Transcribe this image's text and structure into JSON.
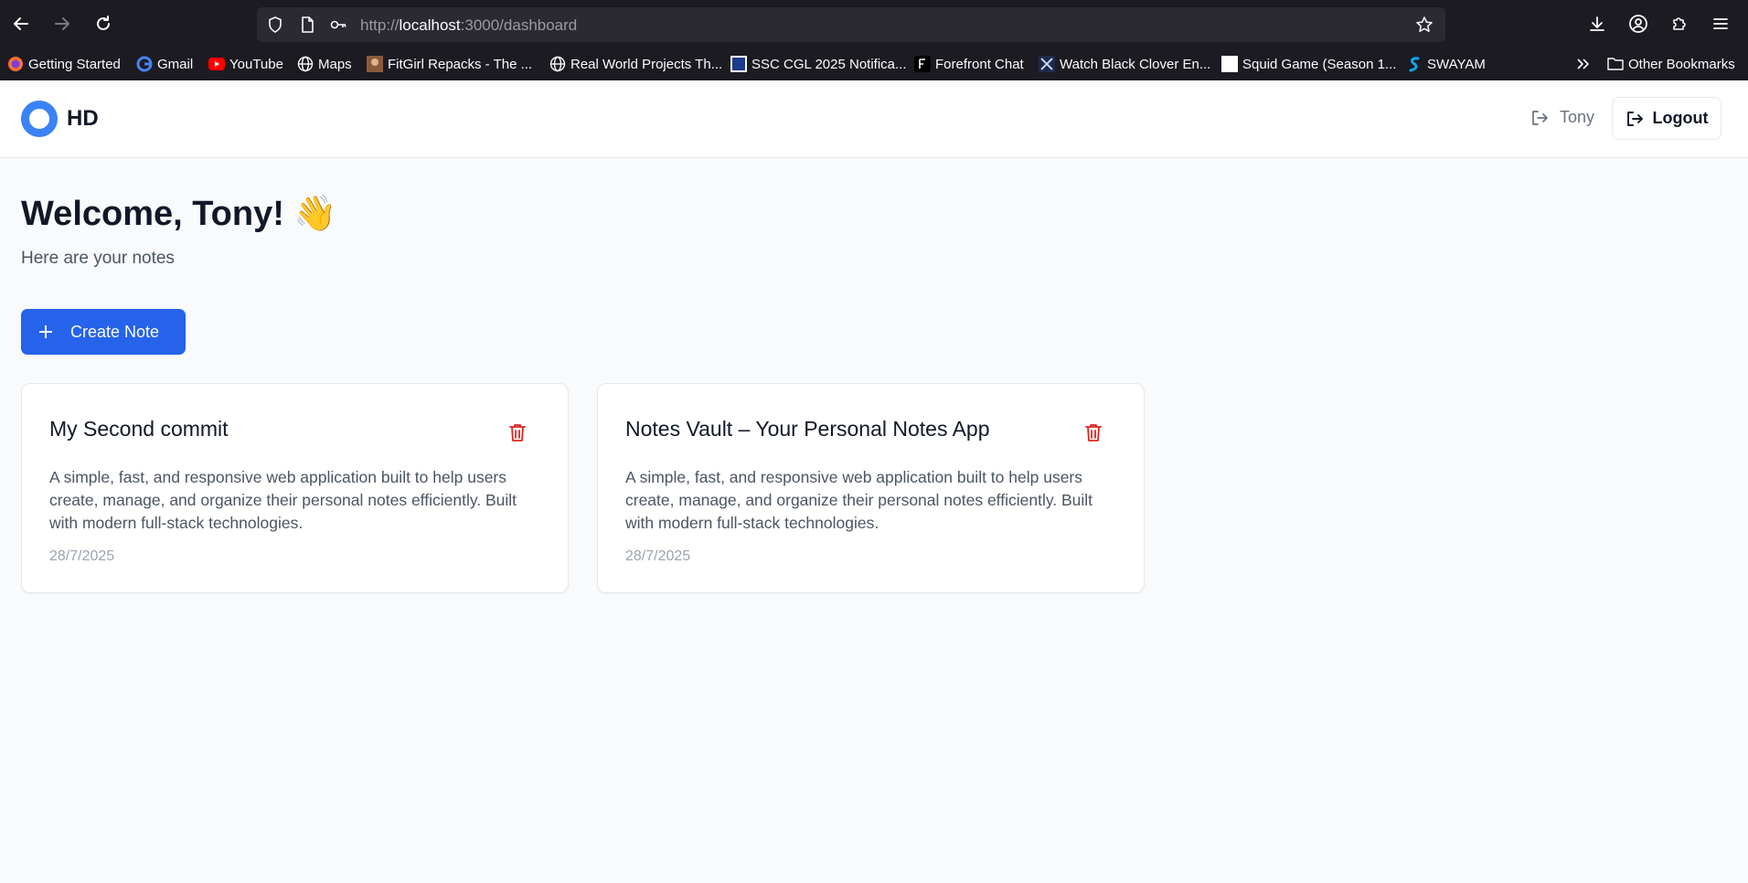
{
  "browser": {
    "url_scheme": "http://",
    "url_host": "localhost",
    "url_path": ":3000/dashboard",
    "bookmarks": [
      {
        "label": "Getting Started",
        "icon": "firefox-icon"
      },
      {
        "label": "Gmail",
        "icon": "google-icon"
      },
      {
        "label": "YouTube",
        "icon": "youtube-icon"
      },
      {
        "label": "Maps",
        "icon": "globe-icon"
      },
      {
        "label": "FitGirl Repacks - The ...",
        "icon": "fitgirl-icon"
      },
      {
        "label": "Real World Projects Th...",
        "icon": "globe-icon"
      },
      {
        "label": "SSC CGL 2025 Notifica...",
        "icon": "jr-icon"
      },
      {
        "label": "Forefront Chat",
        "icon": "forefront-icon"
      },
      {
        "label": "Watch Black Clover En...",
        "icon": "anime-icon"
      },
      {
        "label": "Squid Game (Season 1...",
        "icon": "blank-page-icon"
      },
      {
        "label": "SWAYAM",
        "icon": "swayam-icon"
      }
    ],
    "other_bookmarks": "Other Bookmarks"
  },
  "app": {
    "logo_text": "HD",
    "user_name": "Tony",
    "logout_label": "Logout"
  },
  "main": {
    "welcome": "Welcome, Tony! 👋",
    "subtitle": "Here are your notes",
    "create_label": "Create Note",
    "notes": [
      {
        "title": "My Second commit",
        "body": "A simple, fast, and responsive web application built to help users create, manage, and organize their personal notes efficiently. Built with modern full-stack technologies.",
        "date": "28/7/2025"
      },
      {
        "title": "Notes Vault – Your Personal Notes App",
        "body": "A simple, fast, and responsive web application built to help users create, manage, and organize their personal notes efficiently. Built with modern full-stack technologies.",
        "date": "28/7/2025"
      }
    ]
  },
  "colors": {
    "primary": "#2563eb",
    "logo": "#3b82f6",
    "danger": "#dc2626",
    "chrome": "#1c1b22"
  }
}
